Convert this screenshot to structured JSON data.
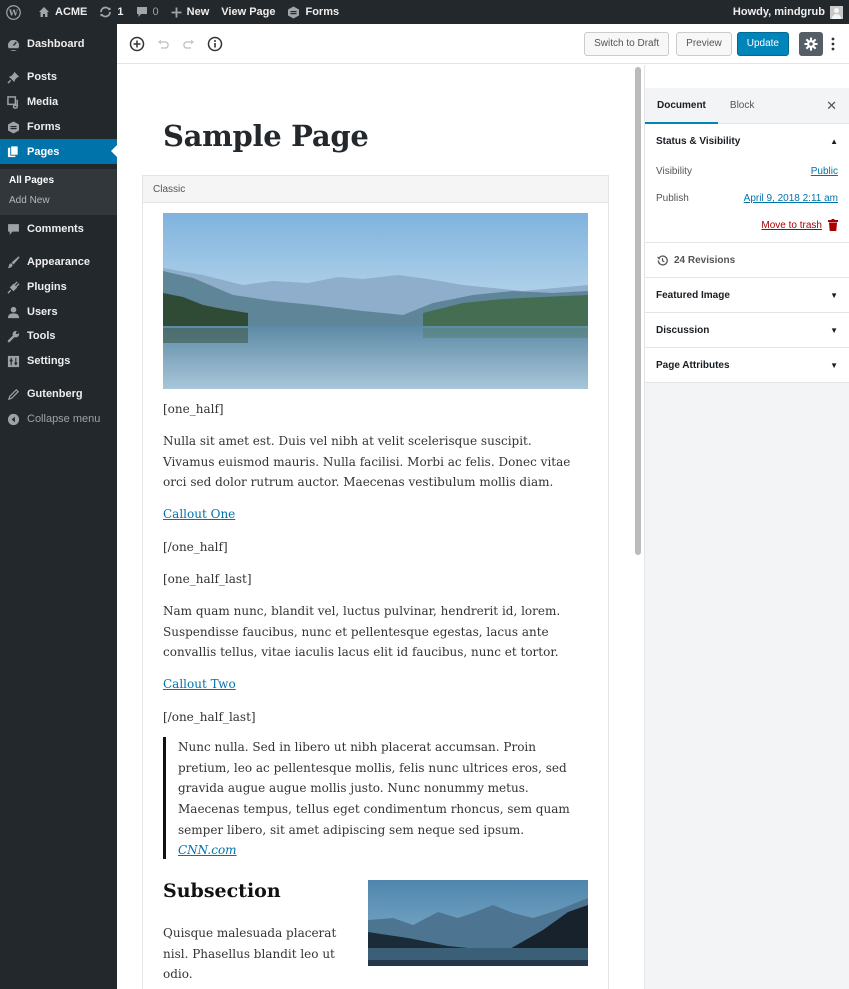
{
  "admin_bar": {
    "site_name": "ACME",
    "updates_count": "1",
    "comments_count": "0",
    "new_label": "New",
    "view_page_label": "View Page",
    "forms_label": "Forms",
    "greeting": "Howdy, mindgrub",
    "icons": [
      "wordpress-logo-icon",
      "home-icon",
      "updates-icon",
      "comment-icon",
      "plus-icon",
      "forms-icon",
      "avatar-icon"
    ]
  },
  "admin_menu": {
    "items": [
      {
        "label": "Dashboard",
        "icon": "dashboard-icon"
      },
      {
        "label": "Posts",
        "icon": "pin-icon"
      },
      {
        "label": "Media",
        "icon": "media-icon"
      },
      {
        "label": "Forms",
        "icon": "forms-icon"
      },
      {
        "label": "Pages",
        "icon": "pages-icon",
        "current": true
      },
      {
        "label": "Comments",
        "icon": "comment-icon"
      },
      {
        "label": "Appearance",
        "icon": "brush-icon"
      },
      {
        "label": "Plugins",
        "icon": "plugin-icon"
      },
      {
        "label": "Users",
        "icon": "user-icon"
      },
      {
        "label": "Tools",
        "icon": "wrench-icon"
      },
      {
        "label": "Settings",
        "icon": "settings-icon"
      },
      {
        "label": "Gutenberg",
        "icon": "pencil-icon"
      }
    ],
    "submenu": [
      {
        "label": "All Pages",
        "current": true
      },
      {
        "label": "Add New"
      }
    ],
    "collapse_label": "Collapse menu",
    "accent_color": "#0073aa"
  },
  "editor_header": {
    "tools": [
      "add-block-icon",
      "undo-icon",
      "redo-icon",
      "info-icon"
    ],
    "switch_to_draft_label": "Switch to Draft",
    "preview_label": "Preview",
    "update_label": "Update",
    "primary_color": "#0085ba"
  },
  "content": {
    "page_title": "Sample Page",
    "block_label": "Classic",
    "hero_image_alt": "Lake with forested mountains",
    "shortcode_1": "[one_half]",
    "para_1": "Nulla sit amet est. Duis vel nibh at velit scelerisque suscipit. Vivamus euismod mauris. Nulla facilisi. Morbi ac felis. Donec vitae orci sed dolor rutrum auctor. Maecenas vestibulum mollis diam.",
    "link_1": "Callout One",
    "shortcode_2": "[/one_half]",
    "shortcode_3": "[one_half_last]",
    "para_2": "Nam quam nunc, blandit vel, luctus pulvinar, hendrerit id, lorem. Suspendisse faucibus, nunc et pellentesque egestas, lacus ante convallis tellus, vitae iaculis lacus elit id faucibus, nunc et tortor.",
    "link_2": "Callout Two",
    "shortcode_4": "[/one_half_last]",
    "quote_text": "Nunc nulla. Sed in libero ut nibh placerat accumsan. Proin pretium, leo ac pellentesque mollis, felis nunc ultrices eros, sed gravida augue augue mollis justo. Nunc nonummy metus. Maecenas tempus, tellus eget condimentum rhoncus, sem quam semper libero, sit amet adipiscing sem neque sed ipsum.",
    "quote_cite": "CNN.com",
    "subsection_title": "Subsection",
    "subsection_text": "Quisque malesuada placerat nisl. Phasellus blandit leo ut odio.",
    "sub_image_alt": "Mountain lake at dusk"
  },
  "settings_sidebar": {
    "tabs": [
      {
        "label": "Document",
        "active": true
      },
      {
        "label": "Block"
      }
    ],
    "status_panel": {
      "title": "Status & Visibility",
      "visibility_label": "Visibility",
      "visibility_value": "Public",
      "publish_label": "Publish",
      "publish_value": "April 9, 2018 2:11 am",
      "trash_label": "Move to trash"
    },
    "revisions_label": "24 Revisions",
    "panels": [
      {
        "title": "Featured Image"
      },
      {
        "title": "Discussion"
      },
      {
        "title": "Page Attributes"
      }
    ],
    "trash_color": "#aa0000"
  }
}
